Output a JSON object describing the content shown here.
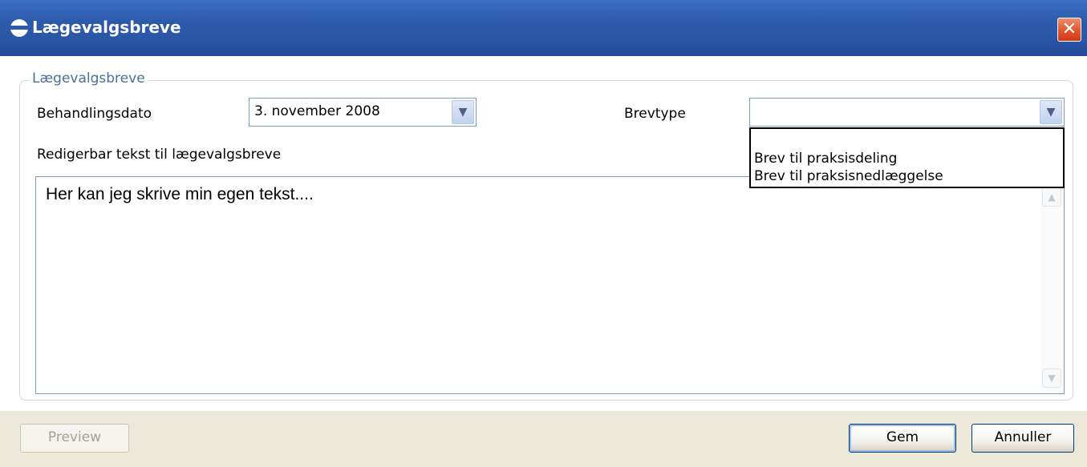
{
  "window": {
    "title": "Lægevalgsbreve",
    "close_symbol": "✕"
  },
  "group": {
    "legend": "Lægevalgsbreve"
  },
  "form": {
    "date_label": "Behandlingsdato",
    "date_value": "3. november 2008",
    "type_label": "Brevtype",
    "type_value": "",
    "type_options": [
      "Brev til praksisdeling",
      "Brev til praksisnedlæggelse"
    ],
    "text_label": "Redigerbar tekst til lægevalgsbreve",
    "text_value": "Her kan jeg skrive min egen tekst...."
  },
  "buttons": {
    "preview": "Preview",
    "save": "Gem",
    "cancel": "Annuller"
  },
  "icons": {
    "app": "app-logo-icon",
    "close": "close-icon",
    "dropdown": "chevron-down-icon",
    "scroll_up": "scroll-up-icon",
    "scroll_down": "scroll-down-icon"
  },
  "colors": {
    "titlebar": "#2c5aab",
    "close_button": "#e4542e",
    "legend_text": "#4a6f9a",
    "window_bg": "#ece9d8"
  }
}
